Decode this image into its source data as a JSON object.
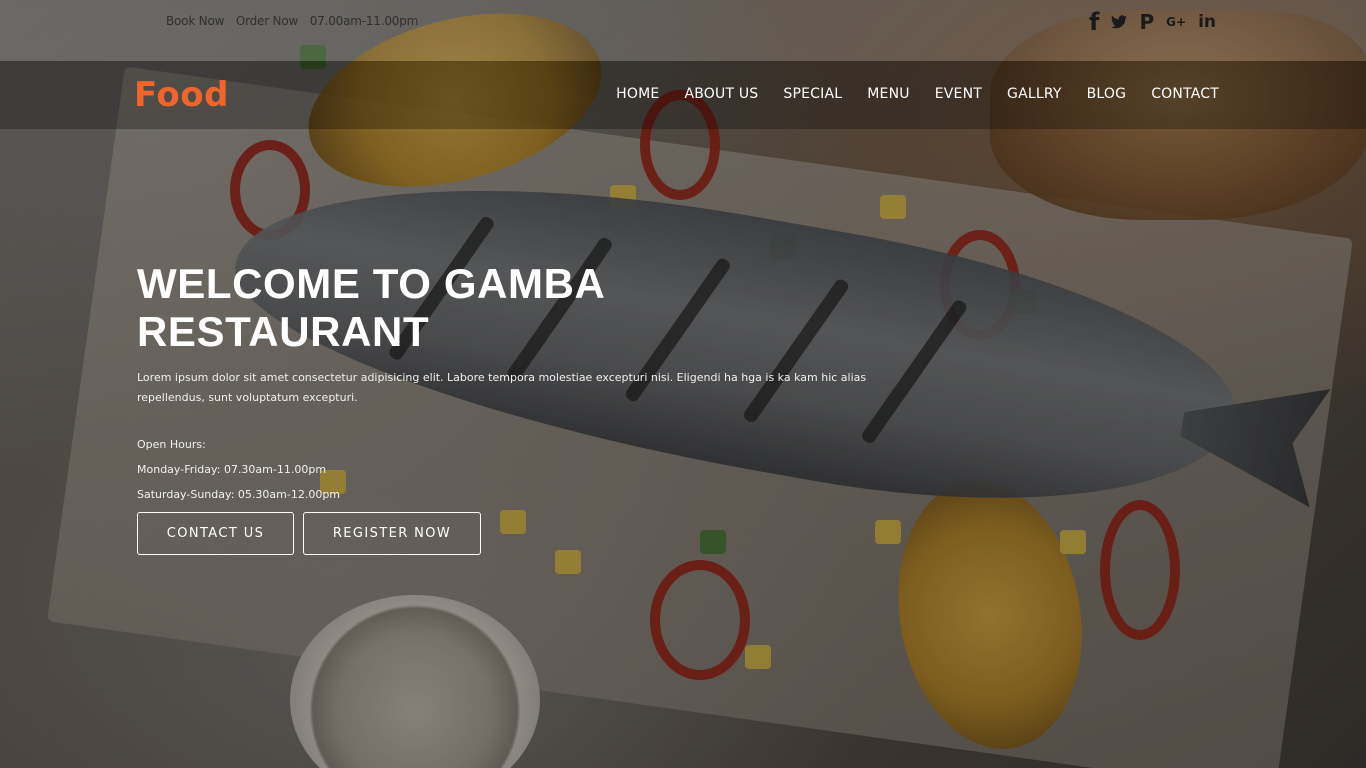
{
  "topbar": {
    "book_now": "Book Now",
    "order_now": "Order Now",
    "time": "07.00am-11.00pm",
    "social": [
      {
        "icon": "facebook-icon",
        "glyph": "f"
      },
      {
        "icon": "twitter-icon",
        "glyph": "🐦"
      },
      {
        "icon": "pinterest-icon",
        "glyph": "P"
      },
      {
        "icon": "google-plus-icon",
        "glyph": "G+"
      },
      {
        "icon": "linkedin-icon",
        "glyph": "in"
      }
    ]
  },
  "navbar": {
    "logo": "Food",
    "menu": [
      "HOME",
      "ABOUT US",
      "SPECIAL",
      "MENU",
      "EVENT",
      "GALLRY",
      "BLOG",
      "CONTACT"
    ]
  },
  "hero": {
    "title": "WELCOME TO GAMBA RESTAURANT",
    "description": "Lorem ipsum dolor sit amet consectetur adipisicing elit. Labore tempora molestiae excepturi nisi. Eligendi ha hga is ka kam hic alias repellendus, sunt voluptatum excepturi.",
    "hours_label": "Open Hours:",
    "weekday_hours": "Monday-Friday: 07.30am-11.00pm",
    "weekend_hours": "Saturday-Sunday: 05.30am-12.00pm",
    "contact_button": "CONTACT US",
    "register_button": "REGISTER NOW"
  },
  "colors": {
    "logo": "#f0662a",
    "text": "#ffffff"
  }
}
